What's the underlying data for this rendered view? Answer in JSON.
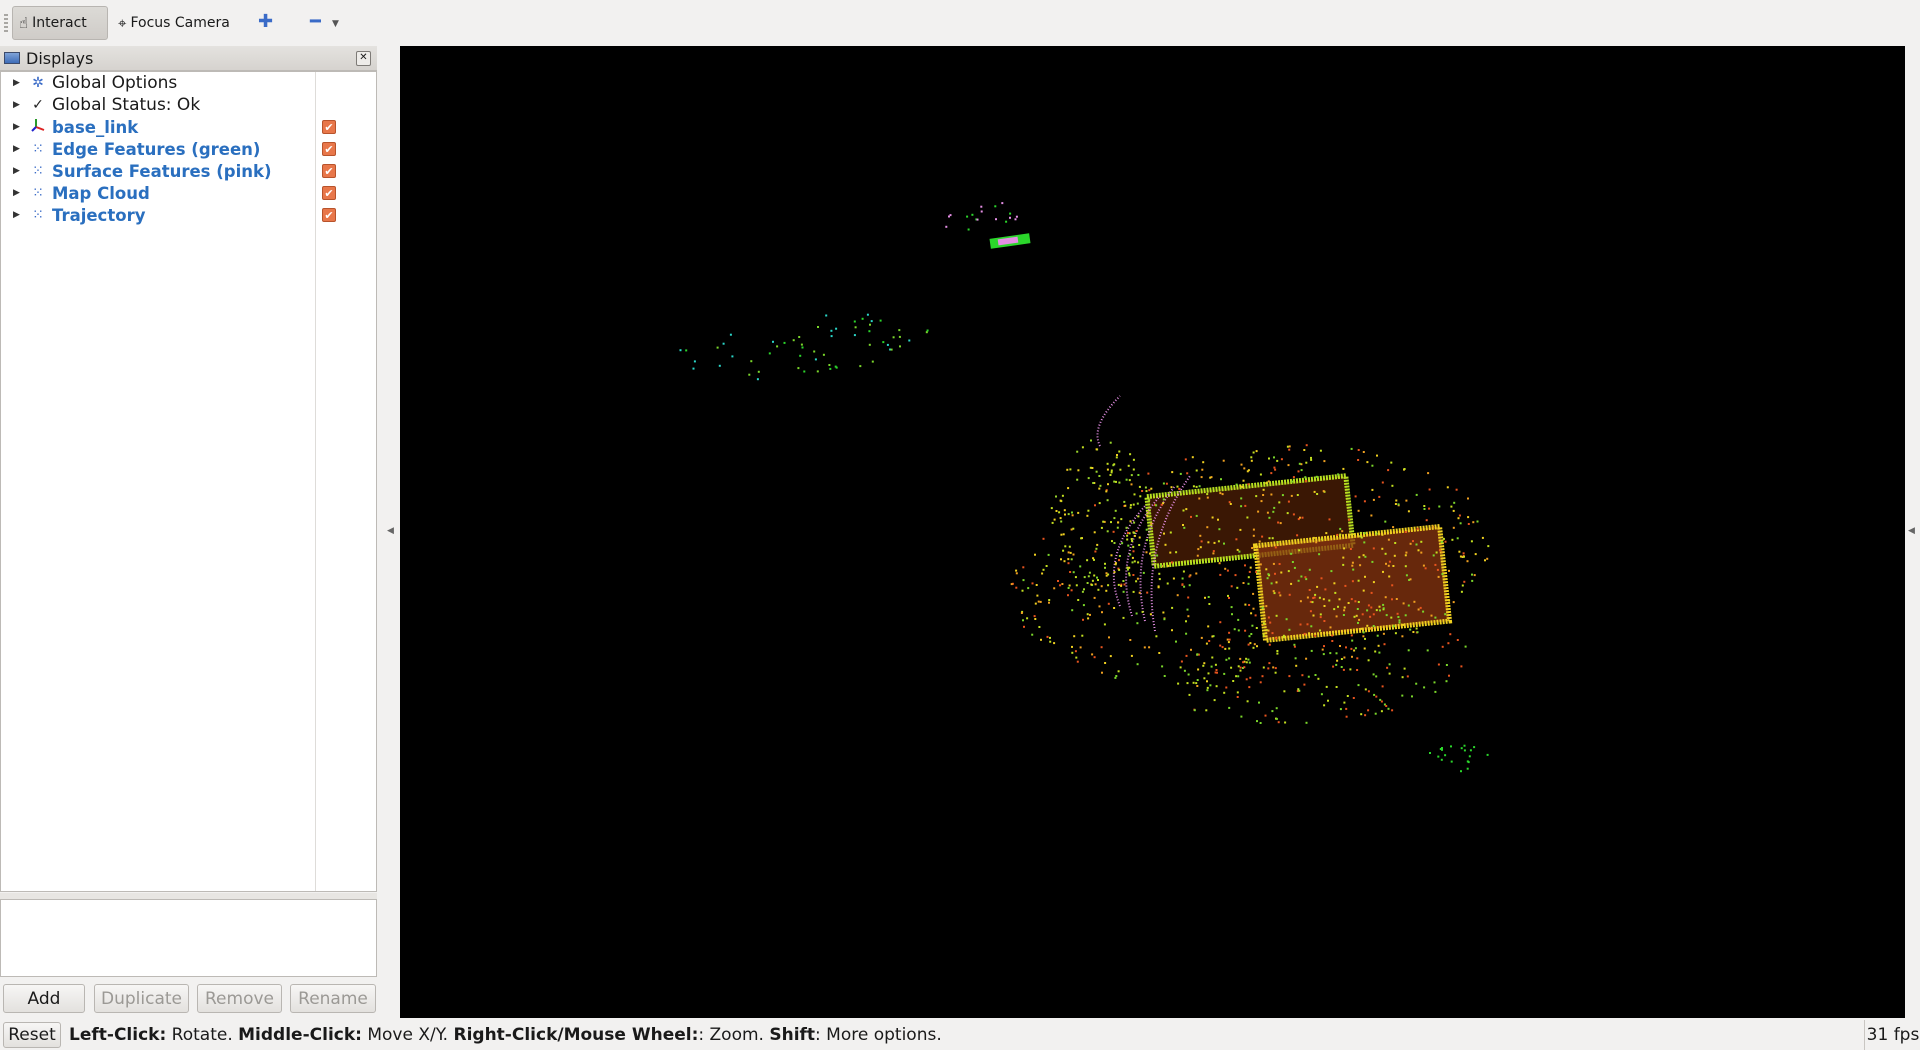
{
  "toolbar": {
    "interact_label": "Interact",
    "focus_camera_label": "Focus Camera",
    "add_tool_icon": "plus-icon",
    "remove_tool_icon": "minus-icon"
  },
  "displays": {
    "title": "Displays",
    "items": [
      {
        "label": "Global Options",
        "icon": "gear-icon",
        "checked": null
      },
      {
        "label": "Global Status: Ok",
        "icon": "checkmark-icon",
        "checked": null
      },
      {
        "label": "base_link",
        "icon": "axes-icon",
        "checked": true
      },
      {
        "label": "Edge Features (green)",
        "icon": "pointcloud-icon",
        "checked": true
      },
      {
        "label": "Surface Features (pink)",
        "icon": "pointcloud-icon",
        "checked": true
      },
      {
        "label": "Map Cloud",
        "icon": "pointcloud-icon",
        "checked": true
      },
      {
        "label": "Trajectory",
        "icon": "pointcloud-icon",
        "checked": true
      }
    ],
    "buttons": {
      "add": "Add",
      "duplicate": "Duplicate",
      "remove": "Remove",
      "rename": "Rename"
    }
  },
  "statusbar": {
    "reset": "Reset",
    "help": {
      "left_click": "Left-Click:",
      "left_click_desc": " Rotate. ",
      "middle_click": "Middle-Click:",
      "middle_click_desc": " Move X/Y. ",
      "right_click": "Right-Click/Mouse Wheel:",
      "right_click_desc": ": Zoom. ",
      "shift": "Shift",
      "shift_desc": ": More options."
    },
    "fps": "31 fps"
  },
  "colors": {
    "viewport_bg": "#000000",
    "edge_features": "#2bd62b",
    "surface_features": "#e48ee4",
    "map_cloud_hot": "#e8541e",
    "map_cloud_warm": "#f0c71a",
    "display_label_blue": "#2a6fbf",
    "checkbox": "#e8774a"
  }
}
